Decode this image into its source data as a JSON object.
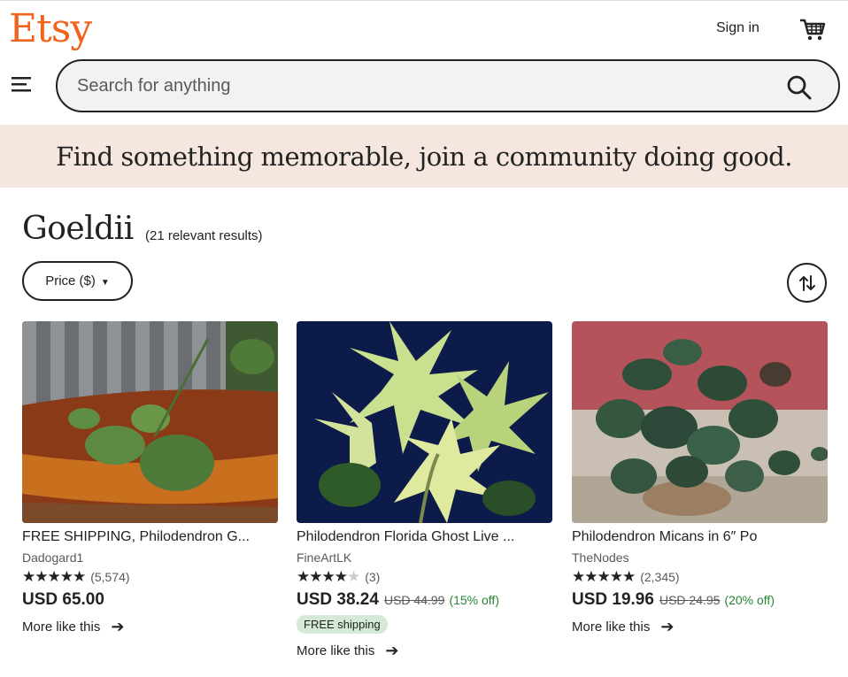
{
  "header": {
    "logo": "Etsy",
    "sign_in": "Sign in"
  },
  "search": {
    "placeholder": "Search for anything"
  },
  "banner": {
    "text": "Find something memorable, join a community doing good."
  },
  "results": {
    "query": "Goeldii",
    "count_text": "(21 relevant results)"
  },
  "filters": {
    "price_label": "Price ($)"
  },
  "colors": {
    "brand": "#F1641E",
    "banner_bg": "#F5E6E0",
    "discount_green": "#258635",
    "free_shipping_bg": "#D4E9D7"
  },
  "listings": [
    {
      "title": "FREE SHIPPING, Philodendron G...",
      "shop": "Dadogard1",
      "stars": 5,
      "reviews": "(5,574)",
      "price": "USD 65.00",
      "original_price": "",
      "discount": "",
      "badge": "",
      "more": "More like this"
    },
    {
      "title": "Philodendron Florida Ghost Live ...",
      "shop": "FineArtLK",
      "stars": 4,
      "reviews": "(3)",
      "price": "USD 38.24",
      "original_price": "USD 44.99",
      "discount": "(15% off)",
      "badge": "FREE shipping",
      "more": "More like this"
    },
    {
      "title": "Philodendron Micans in 6″ Po",
      "shop": "TheNodes",
      "stars": 5,
      "reviews": "(2,345)",
      "price": "USD 19.96",
      "original_price": "USD 24.95",
      "discount": "(20% off)",
      "badge": "",
      "more": "More like this"
    }
  ]
}
